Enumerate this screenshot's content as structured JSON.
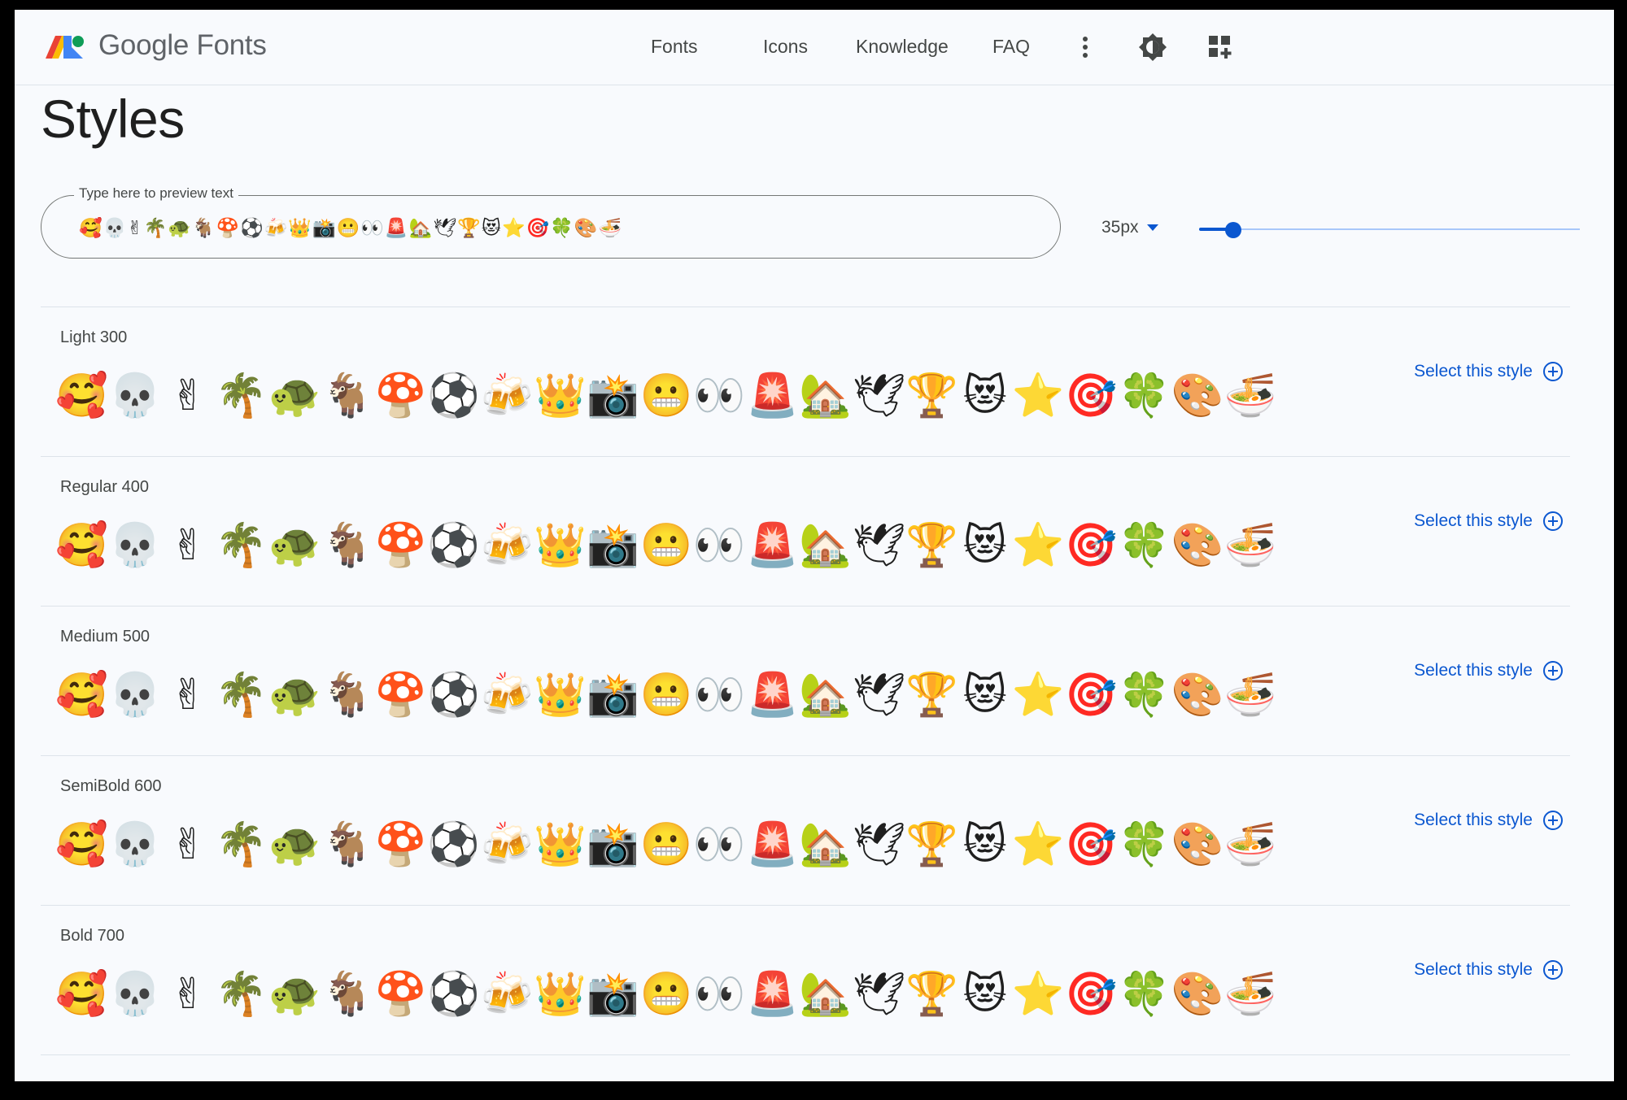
{
  "header": {
    "brand": "Google Fonts",
    "nav": [
      "Fonts",
      "Icons",
      "Knowledge",
      "FAQ"
    ],
    "icons": [
      "more-vert-icon",
      "theme-toggle-icon",
      "apps-grid-icon"
    ]
  },
  "page_title": "Styles",
  "preview": {
    "label": "Type here to preview text",
    "value": "🥰💀✌🌴🐢🐐🍄⚽🍻👑📸😬👀🚨🏡🕊🏆😻⭐🎯🍀🎨🍜",
    "size": "35px",
    "slider_fraction": 0.09
  },
  "styles": [
    {
      "label": "Light 300",
      "button": "Select this style",
      "weight": 300
    },
    {
      "label": "Regular 400",
      "button": "Select this style",
      "weight": 400
    },
    {
      "label": "Medium 500",
      "button": "Select this style",
      "weight": 500
    },
    {
      "label": "SemiBold 600",
      "button": "Select this style",
      "weight": 600
    },
    {
      "label": "Bold 700",
      "button": "Select this style",
      "weight": 700
    }
  ],
  "glyphs": [
    "🥰",
    "💀",
    "✌",
    "🌴",
    "🐢",
    "🐐",
    "🍄",
    "⚽",
    "🍻",
    "👑",
    "📸",
    "😬",
    "👀",
    "🚨",
    "🏡",
    "🕊",
    "🏆",
    "😻",
    "⭐",
    "🎯",
    "🍀",
    "🎨",
    "🍜"
  ],
  "colors": {
    "accent": "#0b57d0",
    "text": "#1f1f1f",
    "background": "#f8fafd"
  }
}
